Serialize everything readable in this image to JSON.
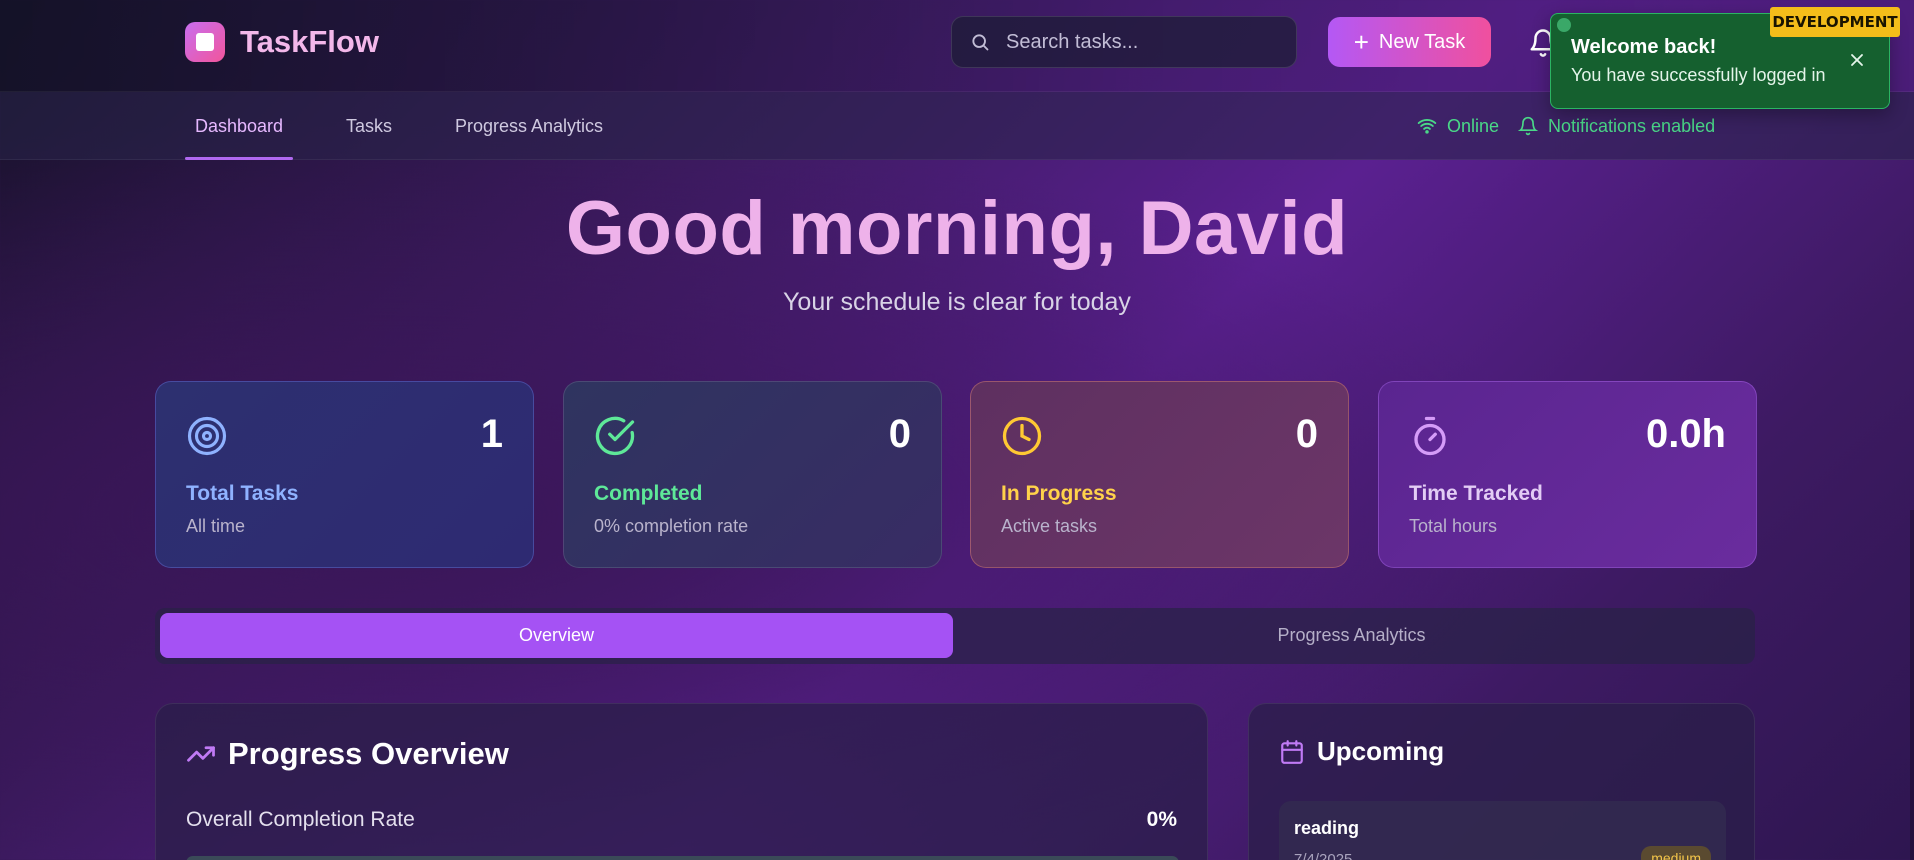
{
  "app": {
    "name": "TaskFlow"
  },
  "header": {
    "search_placeholder": "Search tasks...",
    "new_task_label": "New Task"
  },
  "toast": {
    "title": "Welcome back!",
    "message": "You have successfully logged in"
  },
  "env_badge": "DEVELOPMENT",
  "nav": {
    "tabs": [
      {
        "label": "Dashboard",
        "active": true
      },
      {
        "label": "Tasks",
        "active": false
      },
      {
        "label": "Progress Analytics",
        "active": false
      }
    ],
    "status_online": "Online",
    "status_notifications": "Notifications enabled"
  },
  "hero": {
    "greeting": "Good morning, David",
    "subtitle": "Your schedule is clear for today"
  },
  "stats": [
    {
      "icon": "target-icon",
      "value": "1",
      "label": "Total Tasks",
      "sub": "All time",
      "color": "#8fb2ff"
    },
    {
      "icon": "check-circle-icon",
      "value": "0",
      "label": "Completed",
      "sub": "0% completion rate",
      "color": "#5ee898"
    },
    {
      "icon": "clock-icon",
      "value": "0",
      "label": "In Progress",
      "sub": "Active tasks",
      "color": "#ffd24a"
    },
    {
      "icon": "timer-icon",
      "value": "0.0h",
      "label": "Time Tracked",
      "sub": "Total hours",
      "color": "#d59cf8"
    }
  ],
  "segments": [
    {
      "label": "Overview",
      "active": true
    },
    {
      "label": "Progress Analytics",
      "active": false
    }
  ],
  "progress": {
    "title": "Progress Overview",
    "metric_label": "Overall Completion Rate",
    "metric_value": "0%",
    "completion": 0
  },
  "upcoming": {
    "title": "Upcoming",
    "items": [
      {
        "name": "reading",
        "date": "7/4/2025",
        "priority": "medium"
      }
    ]
  },
  "colors": {
    "accent": "#a552f4",
    "brand_gradient_start": "#b458f5",
    "brand_gradient_end": "#f0509e",
    "success": "#4ad888",
    "warning": "#f4bd1a"
  }
}
